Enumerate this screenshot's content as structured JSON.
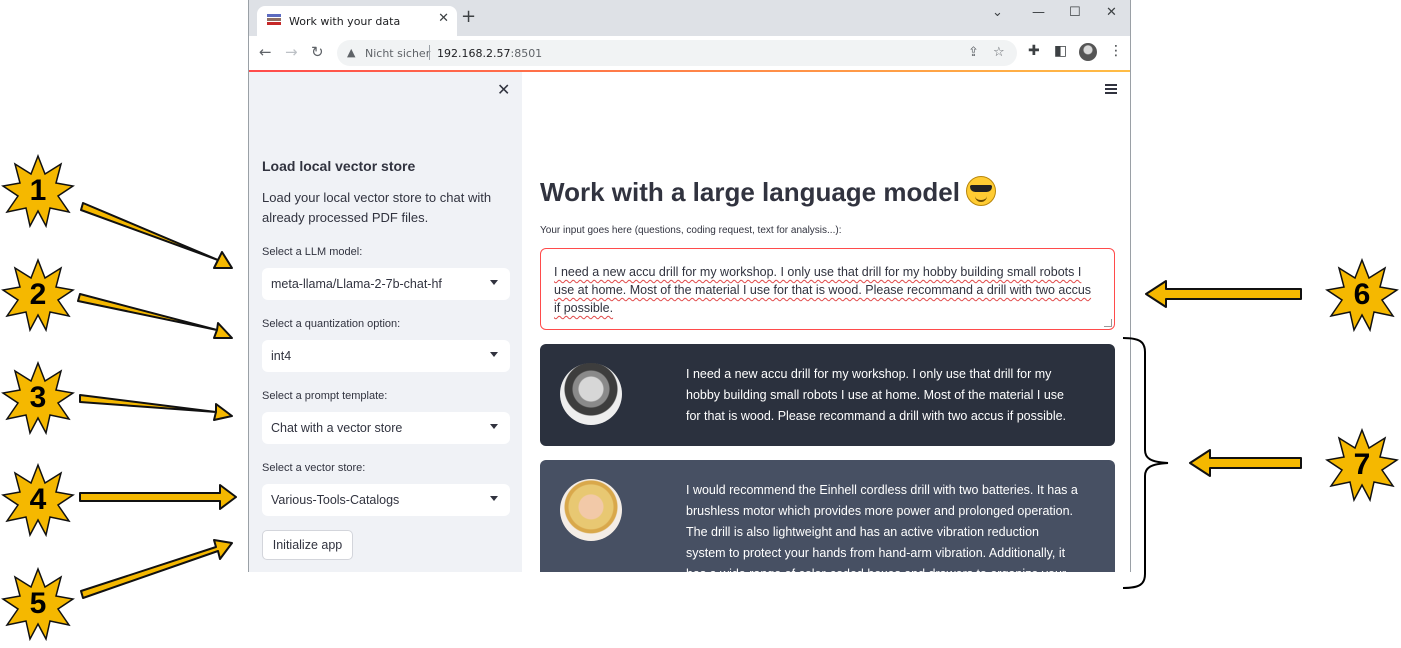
{
  "browser": {
    "tab_title": "Work with your data",
    "tab_close": "✕",
    "new_tab": "+",
    "window_controls": [
      "⌄",
      "—",
      "☐",
      "✕"
    ],
    "nav": {
      "back": "←",
      "forward": "→",
      "reload": "↻"
    },
    "security_icon": "warning-triangle",
    "not_secure_label": "Nicht sicher",
    "url_host": "192.168.2.57",
    "url_port": ":8501"
  },
  "sidebar": {
    "close": "✕",
    "heading": "Load local vector store",
    "description": "Load your local vector store to chat with already processed PDF files.",
    "fields": [
      {
        "label": "Select a LLM model:",
        "value": "meta-llama/Llama-2-7b-chat-hf"
      },
      {
        "label": "Select a quantization option:",
        "value": "int4"
      },
      {
        "label": "Select a prompt template:",
        "value": "Chat with a vector store"
      },
      {
        "label": "Select a vector store:",
        "value": "Various-Tools-Catalogs"
      }
    ],
    "init_button": "Initialize app"
  },
  "main": {
    "title": "Work with a large language model",
    "title_emoji": "sunglasses-face",
    "input_label": "Your input goes here (questions, coding request, text for analysis...):",
    "input_value": "I need a new accu drill for my workshop. I only use that drill for my hobby building small robots I use at home. Most of the material I use for that is wood. Please recommand a drill with two accus if possible.",
    "messages": [
      {
        "role": "user",
        "text": "I need a new accu drill for my workshop. I only use that drill for my hobby building small robots I use at home. Most of the material I use for that is wood. Please recommand a drill with two accus if possible."
      },
      {
        "role": "assistant",
        "text": "I would recommend the Einhell cordless drill with two batteries. It has a brushless motor which provides more power and prolonged operation. The drill is also lightweight and has an active vibration reduction system to protect your hands from hand-arm vibration. Additionally, it has a wide range of color-coded boxes and drawers to organize your"
      }
    ]
  },
  "annotations": [
    "1",
    "2",
    "3",
    "4",
    "5",
    "6",
    "7"
  ],
  "colors": {
    "accent": "#ff4b4b",
    "sidebar_bg": "#f0f2f6",
    "user_msg_bg": "#2b313e",
    "bot_msg_bg": "#475063",
    "marker": "#f5b800"
  }
}
